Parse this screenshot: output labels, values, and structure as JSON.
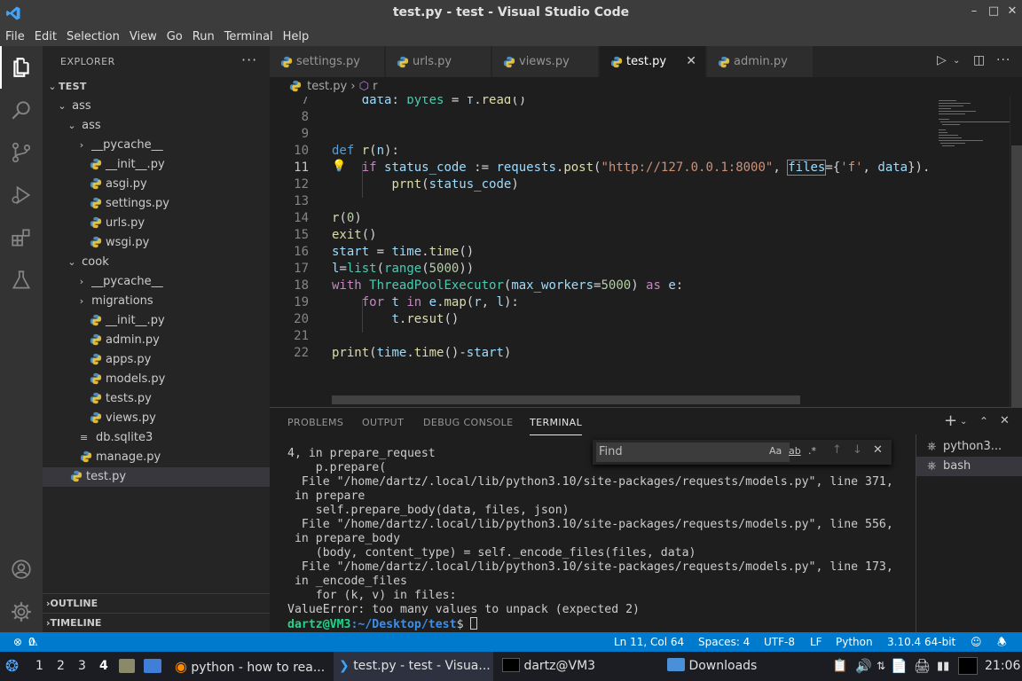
{
  "window": {
    "title": "test.py - test - Visual Studio Code",
    "min": "–",
    "max": "□",
    "close": "✕"
  },
  "menu": [
    "File",
    "Edit",
    "Selection",
    "View",
    "Go",
    "Run",
    "Terminal",
    "Help"
  ],
  "explorer": {
    "header": "EXPLORER",
    "more": "···",
    "root": "TEST",
    "items": [
      {
        "label": "ass",
        "kind": "folder",
        "depth": 1,
        "open": true
      },
      {
        "label": "ass",
        "kind": "folder",
        "depth": 2,
        "open": true
      },
      {
        "label": "__pycache__",
        "kind": "folder",
        "depth": 3,
        "open": false
      },
      {
        "label": "__init__.py",
        "kind": "py",
        "depth": 3
      },
      {
        "label": "asgi.py",
        "kind": "py",
        "depth": 3
      },
      {
        "label": "settings.py",
        "kind": "py",
        "depth": 3
      },
      {
        "label": "urls.py",
        "kind": "py",
        "depth": 3
      },
      {
        "label": "wsgi.py",
        "kind": "py",
        "depth": 3
      },
      {
        "label": "cook",
        "kind": "folder",
        "depth": 2,
        "open": true
      },
      {
        "label": "__pycache__",
        "kind": "folder",
        "depth": 3,
        "open": false
      },
      {
        "label": "migrations",
        "kind": "folder",
        "depth": 3,
        "open": false
      },
      {
        "label": "__init__.py",
        "kind": "py",
        "depth": 3
      },
      {
        "label": "admin.py",
        "kind": "py",
        "depth": 3
      },
      {
        "label": "apps.py",
        "kind": "py",
        "depth": 3
      },
      {
        "label": "models.py",
        "kind": "py",
        "depth": 3
      },
      {
        "label": "tests.py",
        "kind": "py",
        "depth": 3
      },
      {
        "label": "views.py",
        "kind": "py",
        "depth": 3
      },
      {
        "label": "db.sqlite3",
        "kind": "db",
        "depth": 2
      },
      {
        "label": "manage.py",
        "kind": "py",
        "depth": 2
      },
      {
        "label": "test.py",
        "kind": "py",
        "depth": 1,
        "selected": true
      }
    ],
    "outline": "OUTLINE",
    "timeline": "TIMELINE"
  },
  "tabs": [
    {
      "label": "settings.py",
      "active": false
    },
    {
      "label": "urls.py",
      "active": false
    },
    {
      "label": "views.py",
      "active": false
    },
    {
      "label": "test.py",
      "active": true
    },
    {
      "label": "admin.py",
      "active": false
    }
  ],
  "breadcrumb": {
    "file": "test.py",
    "sep": "›",
    "symbol": "r"
  },
  "editor": {
    "lines": [
      {
        "n": "7",
        "html": "    <span class='var'>data</span>: <span class='cls'>bytes</span> = <span class='var'>f</span>.<span class='fn'>read</span>()"
      },
      {
        "n": "8",
        "html": ""
      },
      {
        "n": "9",
        "html": ""
      },
      {
        "n": "10",
        "html": "<span class='kw'>def</span> <span class='fn'>r</span>(<span class='var'>n</span>):"
      },
      {
        "n": "11",
        "html": "    <span class='kw2'>if</span> <span class='var'>status_code</span> := <span class='var'>requests</span>.<span class='fn'>post</span>(<span class='str'>\"http://127.0.0.1:8000\"</span>, <span class='var hl'>files</span>={<span class='str'>'f'</span>, <span class='var'>data</span>}).",
        "cur": true
      },
      {
        "n": "12",
        "html": "        <span class='fn'>prnt</span>(<span class='var'>status_code</span>)"
      },
      {
        "n": "13",
        "html": ""
      },
      {
        "n": "14",
        "html": "<span class='fn'>r</span>(<span class='num'>0</span>)"
      },
      {
        "n": "15",
        "html": "<span class='fn'>exit</span>()"
      },
      {
        "n": "16",
        "html": "<span class='var'>start</span> = <span class='var'>time</span>.<span class='fn'>time</span>()"
      },
      {
        "n": "17",
        "html": "<span class='var'>l</span>=<span class='cls'>list</span>(<span class='cls'>range</span>(<span class='num'>5000</span>))"
      },
      {
        "n": "18",
        "html": "<span class='kw2'>with</span> <span class='cls'>ThreadPoolExecutor</span>(<span class='var'>max_workers</span>=<span class='num'>5000</span>) <span class='kw2'>as</span> <span class='var'>e</span>:"
      },
      {
        "n": "19",
        "html": "    <span class='kw2'>for</span> <span class='var'>t</span> <span class='kw2'>in</span> <span class='var'>e</span>.<span class='fn'>map</span>(<span class='var'>r</span>, <span class='var'>l</span>):"
      },
      {
        "n": "20",
        "html": "        <span class='var'>t</span>.<span class='fn'>resut</span>()"
      },
      {
        "n": "21",
        "html": ""
      },
      {
        "n": "22",
        "html": "<span class='fn'>print</span>(<span class='var'>time</span>.<span class='fn'>time</span>()-<span class='var'>start</span>)"
      }
    ]
  },
  "panel": {
    "tabs": [
      "PROBLEMS",
      "OUTPUT",
      "DEBUG CONSOLE",
      "TERMINAL"
    ],
    "active_tab": "TERMINAL",
    "terminal_lines": [
      "4, in prepare_request",
      "    p.prepare(",
      "  File \"/home/dartz/.local/lib/python3.10/site-packages/requests/models.py\", line 371,",
      " in prepare",
      "    self.prepare_body(data, files, json)",
      "  File \"/home/dartz/.local/lib/python3.10/site-packages/requests/models.py\", line 556,",
      " in prepare_body",
      "    (body, content_type) = self._encode_files(files, data)",
      "  File \"/home/dartz/.local/lib/python3.10/site-packages/requests/models.py\", line 173,",
      " in _encode_files",
      "    for (k, v) in files:",
      "ValueError: too many values to unpack (expected 2)"
    ],
    "prompt_user": "dartz@VM3",
    "prompt_path": ":~/Desktop/test",
    "prompt_sym": "$ ",
    "find_placeholder": "Find",
    "find_opts": [
      "Aa",
      "ab",
      ".*"
    ],
    "terminals": [
      "python3...",
      "bash"
    ]
  },
  "status": {
    "errors": "0",
    "warnings": "0",
    "position": "Ln 11, Col 64",
    "spaces": "Spaces: 4",
    "encoding": "UTF-8",
    "eol": "LF",
    "language": "Python",
    "interpreter": "3.10.4 64-bit"
  },
  "taskbar": {
    "workspaces": [
      "1",
      "2",
      "3",
      "4"
    ],
    "current_ws": "4",
    "apps": [
      {
        "label": "python - how to rea...",
        "icon": "firefox-icon"
      },
      {
        "label": "test.py - test - Visua...",
        "icon": "vscode-icon",
        "active": true
      },
      {
        "label": "dartz@VM3",
        "icon": "terminal-icon"
      },
      {
        "label": "Downloads",
        "icon": "folder-icon"
      }
    ],
    "clock": "21:06"
  },
  "colors": {
    "accent": "#007acc",
    "editor_bg": "#1e1e1e",
    "sidebar_bg": "#252526",
    "activity_bg": "#333333"
  }
}
